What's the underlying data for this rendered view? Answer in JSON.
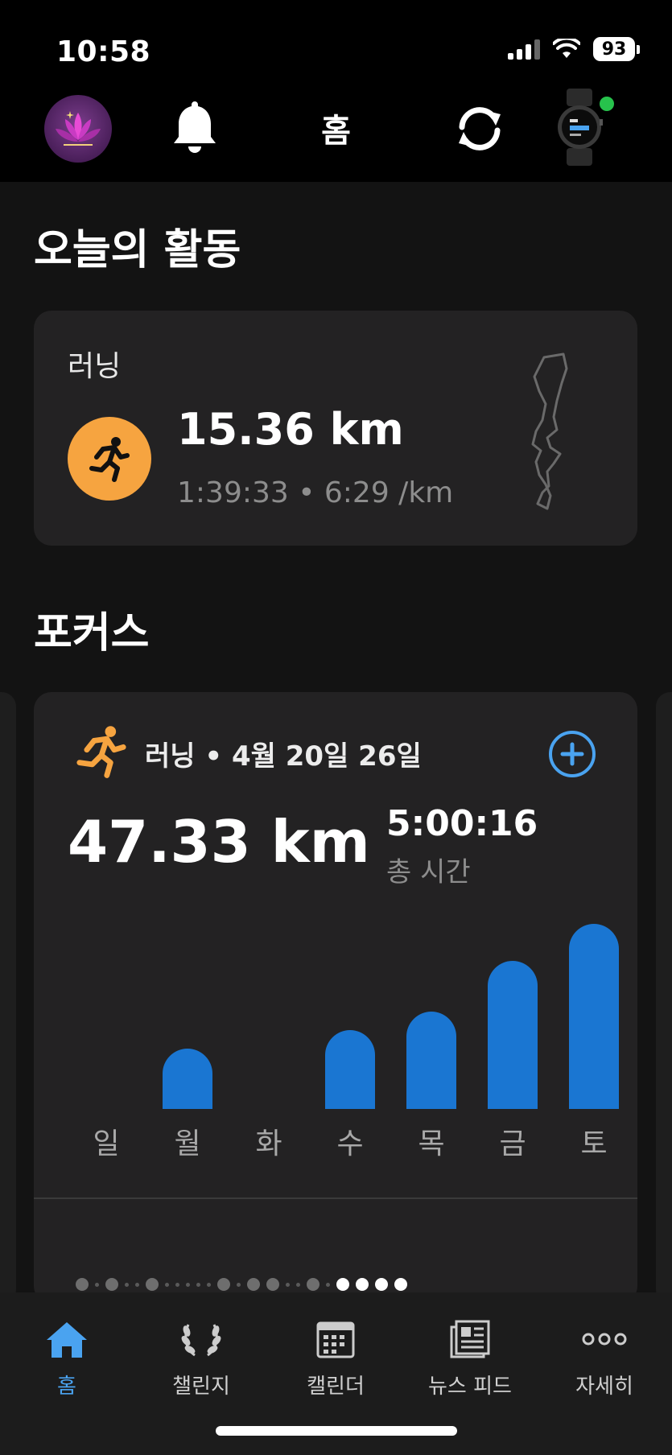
{
  "status": {
    "time": "10:58",
    "battery": "93"
  },
  "header": {
    "title": "홈",
    "avatar_icon": "lotus-icon",
    "bell_icon": "bell-icon",
    "sync_icon": "sync-icon",
    "watch_icon": "watch-icon",
    "watch_status_color": "#27c24c"
  },
  "today": {
    "section_title": "오늘의 활동",
    "activity": {
      "label": "러닝",
      "distance": "15.36 km",
      "detail": "1:39:33 • 6:29 /km",
      "icon": "running-icon",
      "icon_color": "#f6a440"
    }
  },
  "focus": {
    "section_title": "포커스",
    "card": {
      "title": "러닝 • 4월 20일 26일",
      "distance": "47.33 km",
      "total_time": "5:00:16",
      "total_time_label": "총 시간",
      "add_icon": "plus-circle-icon"
    }
  },
  "chart_data": {
    "type": "bar",
    "categories": [
      "일",
      "월",
      "화",
      "수",
      "목",
      "금",
      "토"
    ],
    "values": [
      0,
      1.3,
      0,
      1.7,
      2.1,
      3.2,
      4.0
    ],
    "ylim": [
      0,
      4.0
    ],
    "grid": false,
    "bar_color": "#1a76d2"
  },
  "tabs": [
    {
      "label": "홈",
      "icon": "home-icon",
      "active": true
    },
    {
      "label": "챌린지",
      "icon": "laurel-icon",
      "active": false
    },
    {
      "label": "캘린더",
      "icon": "calendar-icon",
      "active": false
    },
    {
      "label": "뉴스 피드",
      "icon": "newsfeed-icon",
      "active": false
    },
    {
      "label": "자세히",
      "icon": "more-icon",
      "active": false
    }
  ],
  "colors": {
    "accent": "#4aa3f0",
    "background": "#131313",
    "card": "#232223"
  }
}
